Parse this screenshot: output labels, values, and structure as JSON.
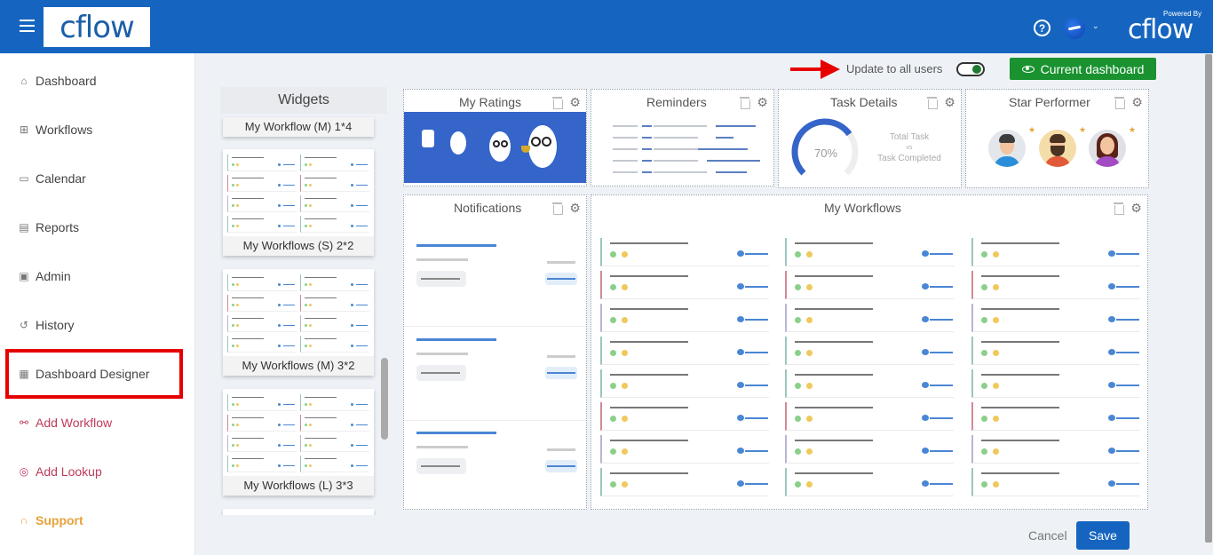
{
  "header": {
    "logo_text": "cflow",
    "powered_by_label": "Powered By",
    "powered_logo_text": "cflow",
    "help_icon_glyph": "?",
    "avatar_caret": "⌄"
  },
  "sidebar": {
    "items": [
      {
        "label": "Dashboard",
        "icon": "home-icon",
        "glyph": "⌂"
      },
      {
        "label": "Workflows",
        "icon": "grid-icon",
        "glyph": "⊞"
      },
      {
        "label": "Calendar",
        "icon": "calendar-icon",
        "glyph": "▭"
      },
      {
        "label": "Reports",
        "icon": "reports-icon",
        "glyph": "▤"
      },
      {
        "label": "Admin",
        "icon": "admin-icon",
        "glyph": "▣"
      },
      {
        "label": "History",
        "icon": "history-icon",
        "glyph": "↺"
      },
      {
        "label": "Dashboard Designer",
        "icon": "dashboard-designer-icon",
        "glyph": "▦"
      },
      {
        "label": "Add Workflow",
        "icon": "add-workflow-icon",
        "glyph": "⚯"
      },
      {
        "label": "Add Lookup",
        "icon": "add-lookup-icon",
        "glyph": "◎"
      },
      {
        "label": "Support",
        "icon": "headset-icon",
        "glyph": "∩"
      }
    ],
    "highlighted": "Dashboard Designer"
  },
  "widgets_panel": {
    "title": "Widgets",
    "items": [
      {
        "label": "My Workflow (M) 1*4"
      },
      {
        "label": "My Workflows (S) 2*2"
      },
      {
        "label": "My Workflows (M) 3*2"
      },
      {
        "label": "My Workflows (L) 3*3"
      }
    ]
  },
  "controls": {
    "update_label": "Update to all users",
    "update_toggle_on": true,
    "current_dashboard_label": "Current dashboard"
  },
  "dashboard": {
    "widgets": {
      "my_ratings": {
        "title": "My Ratings"
      },
      "reminders": {
        "title": "Reminders"
      },
      "task_details": {
        "title": "Task Details",
        "percent": 70,
        "percent_label": "70%",
        "line1": "Total Task",
        "vs": "vs",
        "line2": "Task Completed"
      },
      "star_performer": {
        "title": "Star Performer",
        "star": "★"
      },
      "notifications": {
        "title": "Notifications"
      },
      "my_workflows": {
        "title": "My Workflows"
      }
    },
    "gear_glyph": "⚙"
  },
  "footer": {
    "cancel_label": "Cancel",
    "save_label": "Save"
  },
  "colors": {
    "brand_blue": "#1565c0",
    "green_button": "#19922f",
    "highlight_red": "#e60000",
    "accent_red_text": "#c0395a",
    "support_orange": "#e8a23a"
  }
}
